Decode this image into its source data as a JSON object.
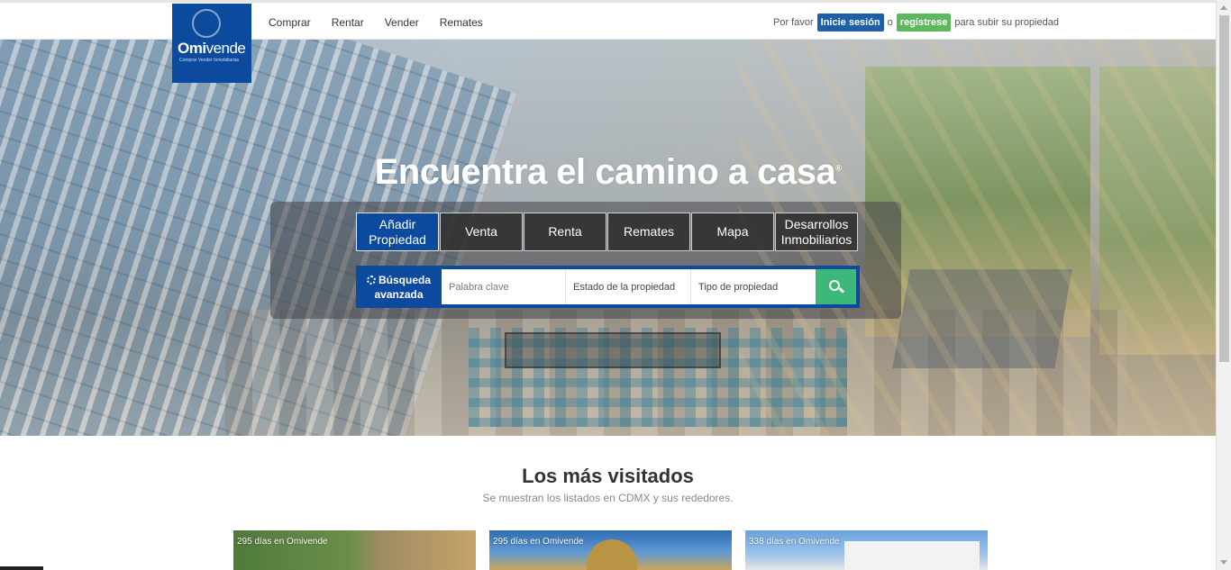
{
  "brand": {
    "logo_text": "Omivende",
    "tagline": "Comprar Vender Inmobiliarias"
  },
  "nav": {
    "items": [
      "Comprar",
      "Rentar",
      "Vender",
      "Remates"
    ]
  },
  "auth": {
    "prefix": "Por favor",
    "login": "Inicie sesión",
    "or": "o",
    "register": "regístrese",
    "suffix": "para subir su propiedad"
  },
  "hero": {
    "title": "Encuentra el camino a casa",
    "title_mark": "®",
    "tabs": [
      "Añadir Propiedad",
      "Venta",
      "Renta",
      "Remates",
      "Mapa",
      "Desarrollos Inmobiliarios"
    ],
    "active_tab": "Añadir Propiedad"
  },
  "search": {
    "advanced_label": "Búsqueda avanzada",
    "keyword_placeholder": "Palabra clave",
    "state_label": "Estado de la propiedad",
    "type_label": "Tipo de propiedad"
  },
  "section": {
    "title": "Los más visitados",
    "subtitle": "Se muestran los listados en CDMX y sus rededores."
  },
  "listings": [
    {
      "days": "295 días en Omivende"
    },
    {
      "days": "295 días en Omivende"
    },
    {
      "days": "338 días en Omivende"
    }
  ],
  "colors": {
    "brand_blue": "#0b4a9c",
    "login_button": "#1f5fa8",
    "register_button": "#5cb85c",
    "search_button": "#3cb878"
  }
}
